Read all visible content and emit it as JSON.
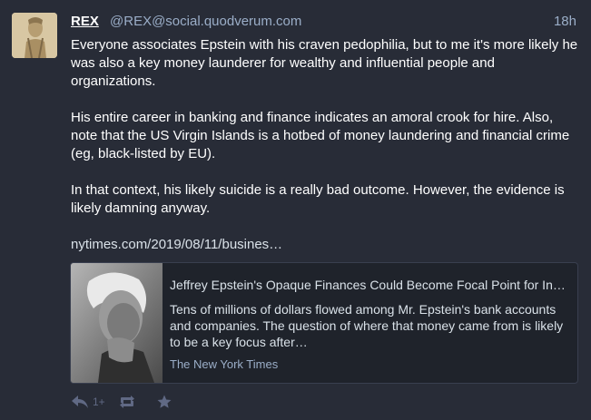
{
  "status": {
    "display_name": "REX",
    "account": "@REX@social.quodverum.com",
    "relative_time": "18h",
    "paragraphs": [
      "Everyone associates Epstein with his craven pedophilia, but to me it's more likely he was also a key money launderer for wealthy and influential people and organizations.",
      "His entire career in banking and finance indicates an amoral crook for hire. Also, note that the US Virgin Islands is a hotbed of money laundering and financial crime (eg, black-listed by EU).",
      "In that context, his likely suicide is a really bad outcome. However, the evidence is likely damning anyway."
    ],
    "link_text": "nytimes.com/2019/08/11/busines…"
  },
  "card": {
    "title": "Jeffrey Epstein's Opaque Finances Could Become Focal Point for Inv…",
    "description": "Tens of millions of dollars flowed among Mr. Epstein's bank accounts and companies. The question of where that money came from is likely to be a key focus after…",
    "provider": "The New York Times"
  },
  "actions": {
    "reply_icon": "reply-icon",
    "reply_count": "1+",
    "boost_icon": "retweet-icon",
    "favourite_icon": "star-icon"
  },
  "colors": {
    "background": "#282c37",
    "secondary_text": "#9baec8",
    "action_icons": "#606984"
  }
}
